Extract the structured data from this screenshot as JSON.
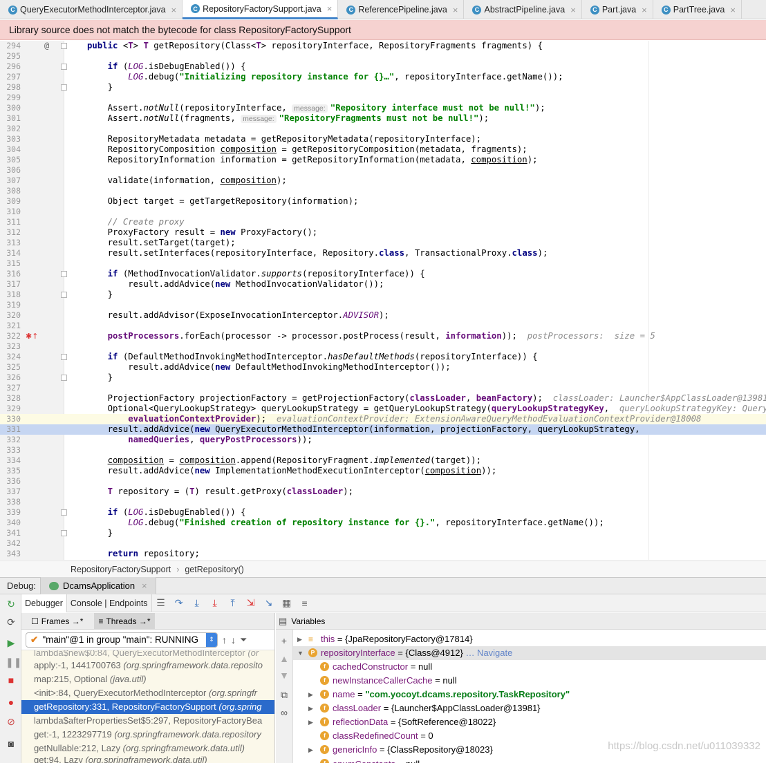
{
  "tabs": [
    {
      "label": "QueryExecutorMethodInterceptor.java",
      "icon": "C",
      "active": false
    },
    {
      "label": "RepositoryFactorySupport.java",
      "icon": "C",
      "active": true
    },
    {
      "label": "ReferencePipeline.java",
      "icon": "C",
      "active": false
    },
    {
      "label": "AbstractPipeline.java",
      "icon": "C",
      "active": false
    },
    {
      "label": "Part.java",
      "icon": "C",
      "active": false
    },
    {
      "label": "PartTree.java",
      "icon": "C",
      "active": false
    }
  ],
  "banner": "Library source does not match the bytecode for class RepositoryFactorySupport",
  "code": {
    "line_numbers": [
      "294",
      "295",
      "296",
      "297",
      "298",
      "299",
      "300",
      "301",
      "302",
      "303",
      "304",
      "305",
      "306",
      "307",
      "308",
      "309",
      "310",
      "311",
      "312",
      "313",
      "314",
      "315",
      "316",
      "317",
      "318",
      "319",
      "320",
      "321",
      "322",
      "323",
      "324",
      "325",
      "326",
      "327",
      "328",
      "329",
      "330",
      "331",
      "332",
      "333",
      "334",
      "335",
      "336",
      "337",
      "338",
      "339",
      "340",
      "341",
      "342",
      "343"
    ],
    "l294": {
      "kw1": "public",
      "a": " <",
      "t1": "T",
      "b": "> ",
      "t2": "T",
      "c": " getRepository(Class<",
      "t3": "T",
      "d": "> repositoryInterface, RepositoryFragments fragments) {"
    },
    "l296": {
      "kw": "if",
      "a": " (",
      "log": "LOG",
      "b": ".isDebugEnabled()) {"
    },
    "l297": {
      "log": "LOG",
      "a": ".debug(",
      "str": "\"Initializing repository instance for {}…\"",
      "b": ", repositoryInterface.getName());"
    },
    "brace": "}",
    "l300": {
      "a": "Assert.",
      "m": "notNull",
      "b": "(repositoryInterface, ",
      "hint": "message:",
      "str": "\"Repository interface must not be null!\"",
      "c": ");"
    },
    "l301": {
      "a": "Assert.",
      "m": "notNull",
      "b": "(fragments, ",
      "hint": "message:",
      "str": "\"RepositoryFragments must not be null!\"",
      "c": ");"
    },
    "l303": "RepositoryMetadata metadata = getRepositoryMetadata(repositoryInterface);",
    "l304": {
      "a": "RepositoryComposition ",
      "u": "composition",
      "b": " = getRepositoryComposition(metadata, fragments);"
    },
    "l305": {
      "a": "RepositoryInformation information = getRepositoryInformation(metadata, ",
      "u": "composition",
      "b": ");"
    },
    "l307": {
      "a": "validate(information, ",
      "u": "composition",
      "b": ");"
    },
    "l309": "Object target = getTargetRepository(information);",
    "l311": "// Create proxy",
    "l312": {
      "a": "ProxyFactory result = ",
      "kw": "new",
      "b": " ProxyFactory();"
    },
    "l313": "result.setTarget(target);",
    "l314": {
      "a": "result.setInterfaces(repositoryInterface, Repository.",
      "kw1": "class",
      "b": ", TransactionalProxy.",
      "kw2": "class",
      "c": ");"
    },
    "l316": {
      "kw": "if",
      "a": " (MethodInvocationValidator.",
      "m": "supports",
      "b": "(repositoryInterface)) {"
    },
    "l317": {
      "a": "result.addAdvice(",
      "kw": "new",
      "b": " MethodInvocationValidator());"
    },
    "l320": {
      "a": "result.addAdvisor(ExposeInvocationInterceptor.",
      "f": "ADVISOR",
      "b": ");"
    },
    "l322": {
      "f": "postProcessors",
      "a": ".forEach(processor -> processor.postProcess(result, ",
      "f2": "information",
      "b": "));",
      "hint": "postProcessors:  size = 5"
    },
    "l324": {
      "kw": "if",
      "a": " (DefaultMethodInvokingMethodInterceptor.",
      "m": "hasDefaultMethods",
      "b": "(repositoryInterface)) {"
    },
    "l325": {
      "a": "result.addAdvice(",
      "kw": "new",
      "b": " DefaultMethodInvokingMethodInterceptor());"
    },
    "l328": {
      "a": "ProjectionFactory projectionFactory = getProjectionFactory(",
      "f1": "classLoader",
      "b": ", ",
      "f2": "beanFactory",
      "c": ");",
      "hint": "classLoader: Launcher$AppClassLoader@13981  beanFa"
    },
    "l329": {
      "a": "Optional<QueryLookupStrategy> queryLookupStrategy = getQueryLookupStrategy(",
      "f": "queryLookupStrategyKey",
      "b": ",",
      "hint": "queryLookupStrategyKey: QueryLookupSt"
    },
    "l330": {
      "f": "evaluationContextProvider",
      "a": ");",
      "hint": "evaluationContextProvider: ExtensionAwareQueryMethodEvaluationContextProvider@18008"
    },
    "l331": {
      "a": "result.addAdvice(",
      "kw": "new",
      "b": " QueryExecutorMethodInterceptor(information, projectionFactory, queryLookupStrategy,"
    },
    "l332": {
      "f1": "namedQueries",
      "a": ", ",
      "f2": "queryPostProcessors",
      "b": "));"
    },
    "l334": {
      "u1": "composition",
      "a": " = ",
      "u2": "composition",
      "b": ".append(RepositoryFragment.",
      "m": "implemented",
      "c": "(target));"
    },
    "l335": {
      "a": "result.addAdvice(",
      "kw": "new",
      "b": " ImplementationMethodExecutionInterceptor(",
      "u": "composition",
      "c": "));"
    },
    "l337": {
      "t1": "T",
      "a": " repository = (",
      "t2": "T",
      "b": ") result.getProxy(",
      "f": "classLoader",
      "c": ");"
    },
    "l339": {
      "kw": "if",
      "a": " (",
      "log": "LOG",
      "b": ".isDebugEnabled()) {"
    },
    "l340": {
      "log": "LOG",
      "a": ".debug(",
      "str": "\"Finished creation of repository instance for {}.\"",
      "b": ", repositoryInterface.getName());"
    },
    "l343": {
      "kw": "return",
      "a": " repository;"
    }
  },
  "breadcrumb": [
    "RepositoryFactorySupport",
    "getRepository()"
  ],
  "debug": {
    "label": "Debug:",
    "app_tab": "DcamsApplication",
    "tab_debugger": "Debugger",
    "tab_console": "Console | Endpoints",
    "frames_tab": "Frames →*",
    "threads_tab": "Threads →*",
    "variables_tab": "Variables",
    "thread": "\"main\"@1 in group \"main\": RUNNING",
    "frames": [
      {
        "method": "lambda$new$0:84, QueryExecutorMethodInterceptor",
        "pkg": "(or",
        "selected": false
      },
      {
        "method": "apply:-1, 1441700763",
        "pkg": "(org.springframework.data.reposito",
        "selected": false
      },
      {
        "method": "map:215, Optional",
        "pkg": "(java.util)",
        "selected": false
      },
      {
        "method": "<init>:84, QueryExecutorMethodInterceptor",
        "pkg": "(org.springfr",
        "selected": false
      },
      {
        "method": "getRepository:331, RepositoryFactorySupport",
        "pkg": "(org.spring",
        "selected": true
      },
      {
        "method": "lambda$afterPropertiesSet$5:297, RepositoryFactoryBea",
        "pkg": "",
        "selected": false
      },
      {
        "method": "get:-1, 1223297719",
        "pkg": "(org.springframework.data.repository",
        "selected": false
      },
      {
        "method": "getNullable:212, Lazy",
        "pkg": "(org.springframework.data.util)",
        "selected": false
      },
      {
        "method": "get:94, Lazy",
        "pkg": "(org.springframework.data.util)",
        "selected": false
      }
    ],
    "variables": [
      {
        "icon": "list",
        "name": "this",
        "eq": " = ",
        "value": "{JpaRepositoryFactory@17814}",
        "nav": "",
        "expand": "collapsed"
      },
      {
        "icon": "P",
        "name": "repositoryInterface",
        "eq": " = ",
        "value": "{Class@4912}",
        "nav": "… Navigate",
        "expand": "expanded"
      },
      {
        "icon": "f",
        "name": "cachedConstructor",
        "eq": " = ",
        "value": "null",
        "nav": "",
        "expand": "none"
      },
      {
        "icon": "f",
        "name": "newInstanceCallerCache",
        "eq": " = ",
        "value": "null",
        "nav": "",
        "expand": "none"
      },
      {
        "icon": "f",
        "name": "name",
        "eq": " = ",
        "value": "\"com.yocoyt.dcams.repository.TaskRepository\"",
        "nav": "",
        "expand": "collapsed"
      },
      {
        "icon": "f",
        "name": "classLoader",
        "eq": " = ",
        "value": "{Launcher$AppClassLoader@13981}",
        "nav": "",
        "expand": "collapsed"
      },
      {
        "icon": "f",
        "name": "reflectionData",
        "eq": " = ",
        "value": "{SoftReference@18022}",
        "nav": "",
        "expand": "collapsed"
      },
      {
        "icon": "f",
        "name": "classRedefinedCount",
        "eq": " = ",
        "value": "0",
        "nav": "",
        "expand": "none"
      },
      {
        "icon": "f",
        "name": "genericInfo",
        "eq": " = ",
        "value": "{ClassRepository@18023}",
        "nav": "",
        "expand": "collapsed"
      },
      {
        "icon": "f",
        "name": "enumConstants",
        "eq": " = ",
        "value": "null",
        "nav": "",
        "expand": "none"
      }
    ]
  },
  "watermark": "https://blog.csdn.net/u011039332"
}
